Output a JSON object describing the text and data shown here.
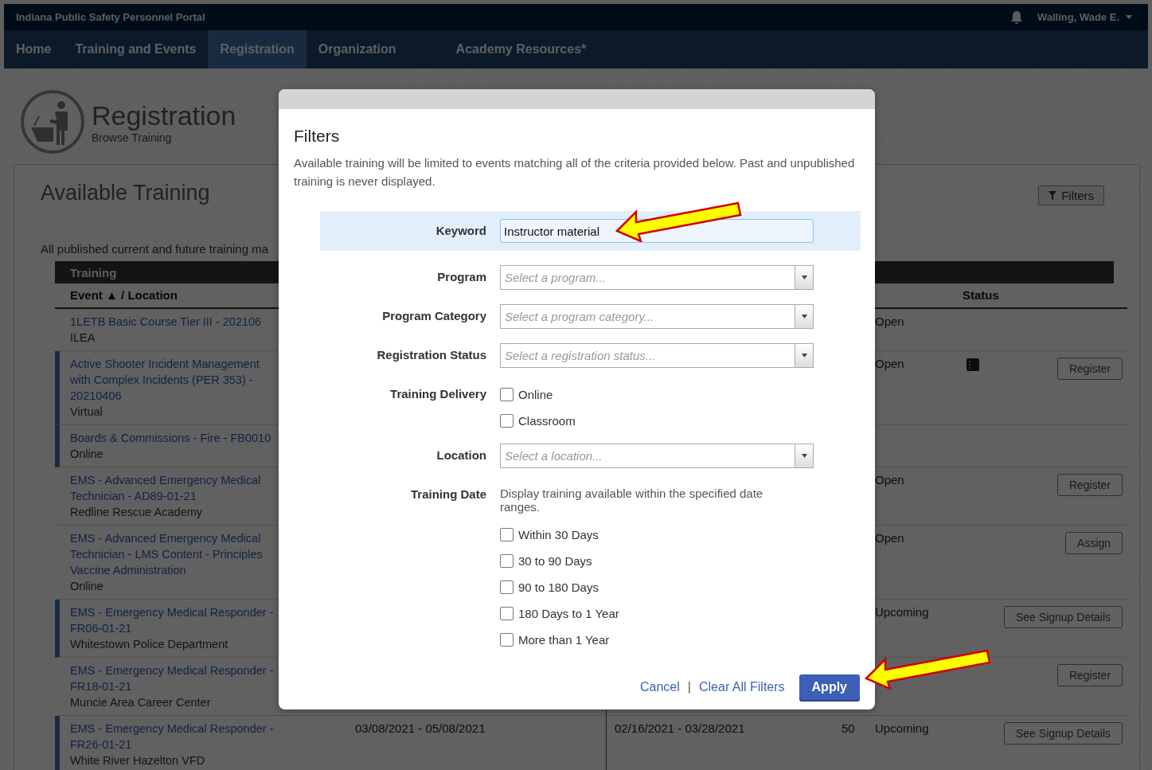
{
  "header": {
    "portal_title": "Indiana Public Safety Personnel Portal",
    "user_name": "Walling, Wade E."
  },
  "nav": [
    {
      "label": "Home",
      "selected": false
    },
    {
      "label": "Training and Events",
      "selected": false
    },
    {
      "label": "Registration",
      "selected": true
    },
    {
      "label": "Organization",
      "selected": false
    },
    {
      "label": "Academy Resources*",
      "selected": false
    }
  ],
  "page": {
    "title": "Registration",
    "subtitle": "Browse Training"
  },
  "panel": {
    "title": "Available Training",
    "filters_button": "Filters",
    "intro": "All published current and future training ma"
  },
  "table": {
    "group_header": "Training",
    "columns": [
      {
        "label": "Event",
        "sorted": true,
        "sort_indicator": "▲",
        "suffix": "/ Location"
      },
      {
        "label": "Status"
      }
    ],
    "rows": [
      {
        "event": "1LETB Basic Course Tier III - 202106",
        "location": "ILEA",
        "marked": false,
        "status": "Open",
        "has_icon": false
      },
      {
        "event": "Active Shooter Incident Management with Complex Incidents (PER 353) - 20210406",
        "location": "Virtual",
        "marked": true,
        "status": "Open",
        "has_icon": true,
        "action": "Register"
      },
      {
        "event": "Boards & Commissions - Fire - FB0010",
        "location": "Online",
        "marked": true,
        "has_icon": false
      },
      {
        "event": "EMS - Advanced Emergency Medical Technician - AD89-01-21",
        "location": "Redline Rescue Academy",
        "marked": false,
        "status": "Open",
        "has_icon": false,
        "action": "Register"
      },
      {
        "event": "EMS - Advanced Emergency Medical Technician - LMS Content - Principles Vaccine Administration",
        "location": "Online",
        "marked": false,
        "status": "Open",
        "has_icon": false,
        "action": "Assign"
      },
      {
        "event": "EMS - Emergency Medical Responder - FR06-01-21",
        "location": "Whitestown Police Department",
        "marked": true,
        "status": "Upcoming",
        "has_icon": false,
        "action": "See Signup Details"
      },
      {
        "event": "EMS - Emergency Medical Responder - FR18-01-21",
        "location": "Muncie Area Career Center",
        "marked": false,
        "has_icon": false,
        "action": "Register"
      },
      {
        "event": "EMS - Emergency Medical Responder - FR26-01-21",
        "location": "White River Hazelton VFD",
        "marked": true,
        "dates_1": "03/08/2021 - 05/08/2021",
        "dates_2": "02/16/2021 - 03/28/2021",
        "count": "50",
        "status": "Upcoming",
        "has_icon": false,
        "action": "See Signup Details"
      }
    ]
  },
  "modal": {
    "title": "Filters",
    "description": "Available training will be limited to events matching all of the criteria provided below. Past and unpublished training is never displayed.",
    "fields": [
      {
        "kind": "text",
        "label": "Keyword",
        "value": "Instructor material",
        "focused": true
      },
      {
        "kind": "select",
        "label": "Program",
        "placeholder": "Select a program...",
        "focused": false
      },
      {
        "kind": "select",
        "label": "Program Category",
        "placeholder": "Select a program category...",
        "focused": false
      },
      {
        "kind": "select",
        "label": "Registration Status",
        "placeholder": "Select a registration status...",
        "focused": false
      },
      {
        "kind": "checkboxes",
        "label": "Training Delivery",
        "focused": false,
        "options": [
          {
            "label": "Online",
            "checked": false
          },
          {
            "label": "Classroom",
            "checked": false
          }
        ]
      },
      {
        "kind": "select",
        "label": "Location",
        "placeholder": "Select a location...",
        "focused": false
      },
      {
        "kind": "checkboxes",
        "label": "Training Date",
        "hint": "Display training available within the specified date ranges.",
        "focused": false,
        "options": [
          {
            "label": "Within 30 Days",
            "checked": false
          },
          {
            "label": "30 to 90 Days",
            "checked": false
          },
          {
            "label": "90 to 180 Days",
            "checked": false
          },
          {
            "label": "180 Days to 1 Year",
            "checked": false
          },
          {
            "label": "More than 1 Year",
            "checked": false
          }
        ]
      }
    ],
    "cancel": "Cancel",
    "separator": "|",
    "clear": "Clear All Filters",
    "apply": "Apply"
  }
}
